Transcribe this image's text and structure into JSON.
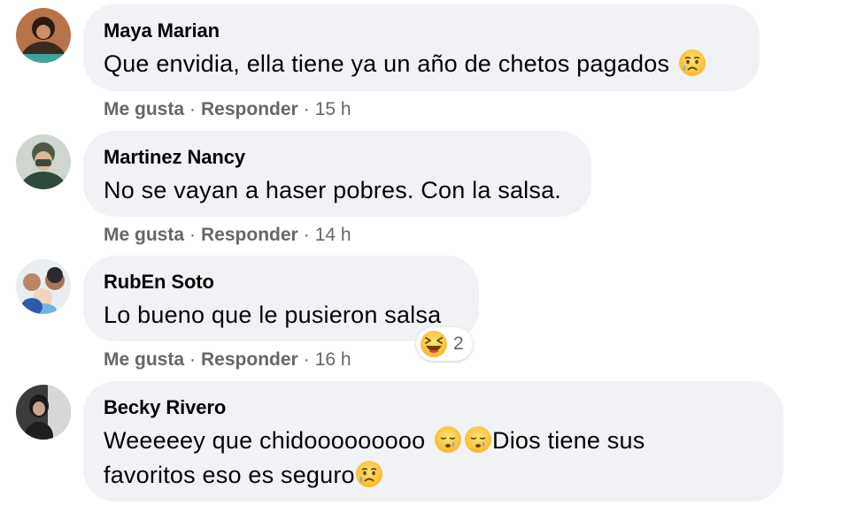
{
  "comments": [
    {
      "author": "Maya Marian",
      "text": "Que envidia, ella tiene ya un año de chetos pagados",
      "trailing_emoji": "crying-face",
      "like_label": "Me gusta",
      "reply_label": "Responder",
      "time": "15 h"
    },
    {
      "author": "Martinez Nancy",
      "text": "No se vayan a haser pobres. Con la salsa.",
      "like_label": "Me gusta",
      "reply_label": "Responder",
      "time": "14 h"
    },
    {
      "author": "RubEn Soto",
      "text": "Lo bueno que le pusieron salsa",
      "like_label": "Me gusta",
      "reply_label": "Responder",
      "time": "16 h",
      "reaction": {
        "emoji": "laughing-face",
        "count": "2"
      }
    },
    {
      "author": "Becky Rivero",
      "text_part1": "Weeeeey que chidooooooooo",
      "text_part2": "Dios tiene sus",
      "text_part3": "favoritos eso es seguro",
      "emojis": [
        "sleepy-face",
        "sleepy-face",
        "crying-face"
      ],
      "like_label": "Me gusta",
      "reply_label": "Responder"
    }
  ],
  "separator": "·",
  "colors": {
    "bubble": "#f0f2f5",
    "text": "#050505",
    "meta": "#65676b",
    "emoji_yellow": "#ffcc4d",
    "tear_blue": "#5dadec"
  }
}
